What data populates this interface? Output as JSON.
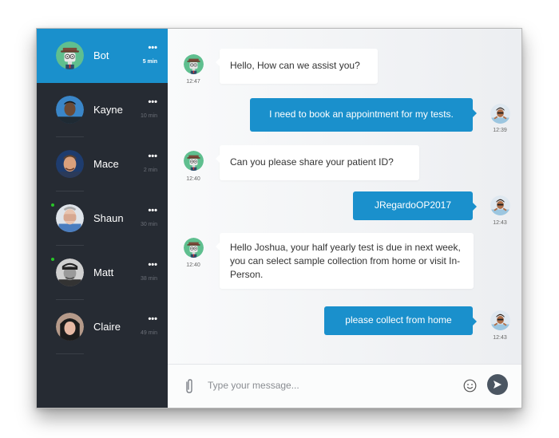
{
  "colors": {
    "accent": "#1a90cc",
    "sidebar_bg": "#262b33",
    "send_button": "#4b5662",
    "online": "#28c428"
  },
  "contacts": [
    {
      "name": "Bot",
      "time": "5 min",
      "more": "•••",
      "active": true,
      "online": false,
      "avatar": "bot-avatar"
    },
    {
      "name": "Kayne",
      "time": "10 min",
      "more": "•••",
      "active": false,
      "online": false,
      "avatar": "user-photo"
    },
    {
      "name": "Mace",
      "time": "2 min",
      "more": "•••",
      "active": false,
      "online": false,
      "avatar": "user-photo"
    },
    {
      "name": "Shaun",
      "time": "30 min",
      "more": "•••",
      "active": false,
      "online": true,
      "avatar": "user-photo"
    },
    {
      "name": "Matt",
      "time": "38 min",
      "more": "•••",
      "active": false,
      "online": true,
      "avatar": "user-photo"
    },
    {
      "name": "Claire",
      "time": "49 min",
      "more": "•••",
      "active": false,
      "online": false,
      "avatar": "user-photo"
    }
  ],
  "messages": [
    {
      "from": "bot",
      "text": "Hello, How can we assist you?",
      "time": "12:47"
    },
    {
      "from": "user",
      "text": "I need to book an appointment for my tests.",
      "time": "12:39"
    },
    {
      "from": "bot",
      "text": "Can you please share your patient ID?",
      "time": "12:40"
    },
    {
      "from": "user",
      "text": "JRegardoOP2017",
      "time": "12:43"
    },
    {
      "from": "bot",
      "text": "Hello Joshua, your half yearly test is due in next week, you can select sample collection from home or visit In-Person.",
      "time": "12:40"
    },
    {
      "from": "user",
      "text": "please collect from home",
      "time": "12:43"
    }
  ],
  "composer": {
    "placeholder": "Type your message...",
    "value": "",
    "attach_icon": "paperclip-icon",
    "emoji_icon": "smiley-icon",
    "send_icon": "send-icon"
  }
}
